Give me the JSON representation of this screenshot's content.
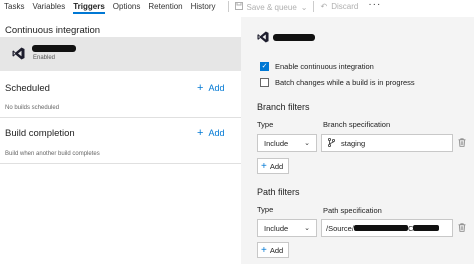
{
  "tabs": [
    "Tasks",
    "Variables",
    "Triggers",
    "Options",
    "Retention",
    "History"
  ],
  "active_tab": "Triggers",
  "toolbar": {
    "save_label": "Save & queue",
    "discard_label": "Discard",
    "more_label": "···"
  },
  "left": {
    "ci": {
      "heading": "Continuous integration",
      "item_status": "Enabled"
    },
    "scheduled": {
      "heading": "Scheduled",
      "add_label": "Add",
      "note": "No builds scheduled"
    },
    "build_completion": {
      "heading": "Build completion",
      "add_label": "Add",
      "note": "Build when another build completes"
    }
  },
  "right": {
    "enable_ci_label": "Enable continuous integration",
    "enable_ci_checked": true,
    "batch_label": "Batch changes while a build is in progress",
    "batch_checked": false,
    "branch_filters": {
      "heading": "Branch filters",
      "type_label": "Type",
      "spec_label": "Branch specification",
      "type_value": "Include",
      "spec_value": "staging",
      "add_label": "Add"
    },
    "path_filters": {
      "heading": "Path filters",
      "type_label": "Type",
      "spec_label": "Path specification",
      "type_value": "Include",
      "spec_prefix": "/Source/",
      "spec_suffix": "C",
      "add_label": "Add"
    }
  },
  "colors": {
    "accent": "#0078d4",
    "selected_bg": "#e6e6e6",
    "panel_bg": "#f4f4f4",
    "vs_purple": "#1e1e2e"
  }
}
